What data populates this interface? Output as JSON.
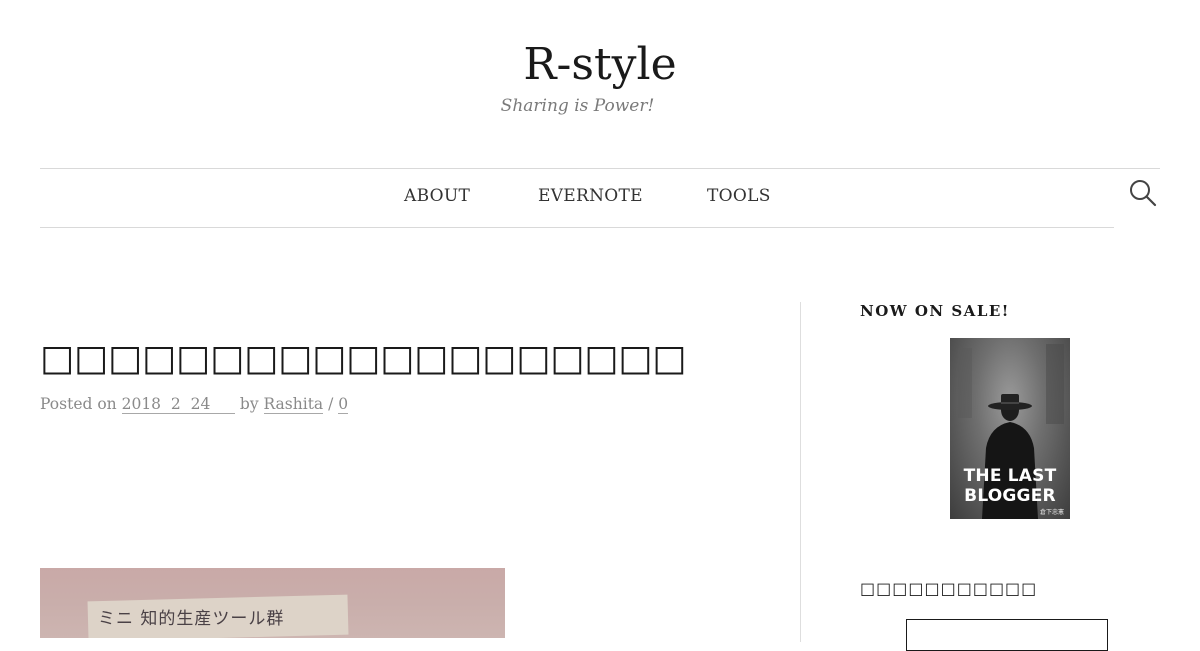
{
  "site": {
    "title": "R-style",
    "tagline": "Sharing is Power!"
  },
  "nav": {
    "items": [
      {
        "label": "ABOUT"
      },
      {
        "label": "EVERNOTE"
      },
      {
        "label": "TOOLS"
      }
    ],
    "search_icon": "search-icon"
  },
  "post": {
    "title": "□□□□□□□□□□□□□□□□□□□",
    "meta": {
      "posted_on_label": "Posted on",
      "date": "2018  2  24     ",
      "by_label": "by",
      "author": "Rashita",
      "separator": "/",
      "comments": "0"
    },
    "image_note_text": "ミニ 知的生産ツール群"
  },
  "sidebar": {
    "widget1_title": "NOW ON SALE!",
    "book": {
      "title_line1": "THE LAST",
      "title_line2": "BLOGGER",
      "author_mark": "倉下忠憲"
    },
    "widget2_title": "□□□□□□□□□□□"
  },
  "colors": {
    "text": "#1a1a1a",
    "muted": "#8a8a8a",
    "rule": "#d9d9d9"
  }
}
